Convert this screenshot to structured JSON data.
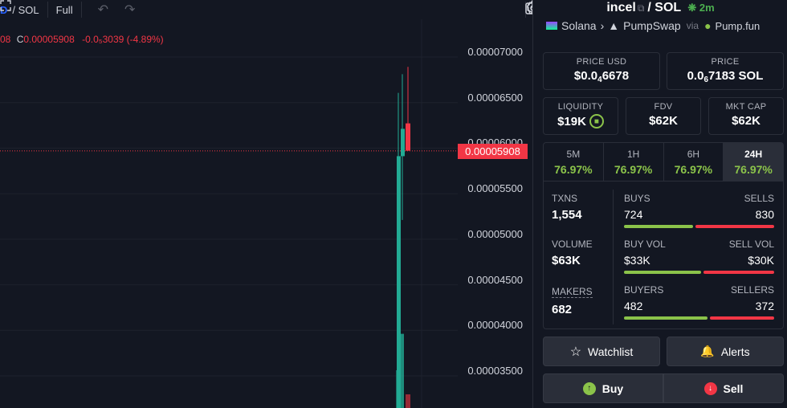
{
  "toolbar": {
    "pair_prefix": "D",
    "pair_suffix": "/ SOL",
    "full_label": "Full"
  },
  "legend": {
    "prefix": "08",
    "close_label": "C",
    "close_value": "0.00005908",
    "change": "-0.0₅3039 (-4.89%)"
  },
  "price_axis": [
    "0.00007000",
    "0.00006500",
    "0.00006000",
    "0.00005500",
    "0.00005000",
    "0.00004500",
    "0.00004000",
    "0.00003500"
  ],
  "current_price": "0.00005908",
  "colors": {
    "up": "#22ab94",
    "down": "#f23645",
    "positive": "#8bc34a",
    "background": "#131722"
  },
  "panel": {
    "token": "incel",
    "quote": "SOL",
    "age": "2m",
    "chain": "Solana",
    "dex": "PumpSwap",
    "via": "via",
    "launchpad": "Pump.fun",
    "price_usd_label": "PRICE USD",
    "price_usd_a": "$0.0",
    "price_usd_sub": "4",
    "price_usd_b": "6678",
    "price_label": "PRICE",
    "price_a": "0.0",
    "price_sub": "6",
    "price_b": "7183 SOL",
    "liquidity_label": "LIQUIDITY",
    "liquidity": "$19K",
    "fdv_label": "FDV",
    "fdv": "$62K",
    "mcap_label": "MKT CAP",
    "mcap": "$62K",
    "tabs": [
      {
        "label": "5M",
        "pct": "76.97%"
      },
      {
        "label": "1H",
        "pct": "76.97%"
      },
      {
        "label": "6H",
        "pct": "76.97%"
      },
      {
        "label": "24H",
        "pct": "76.97%"
      }
    ],
    "txns_label": "TXNS",
    "txns": "1,554",
    "buys_label": "BUYS",
    "buys": "724",
    "sells_label": "SELLS",
    "sells": "830",
    "buys_ratio": 0.466,
    "volume_label": "VOLUME",
    "volume": "$63K",
    "buyvol_label": "BUY VOL",
    "buyvol": "$33K",
    "sellvol_label": "SELL VOL",
    "sellvol": "$30K",
    "buyvol_ratio": 0.524,
    "makers_label": "MAKERS",
    "makers": "682",
    "buyers_label": "BUYERS",
    "buyers": "482",
    "sellers_label": "SELLERS",
    "sellers": "372",
    "buyers_ratio": 0.564,
    "watchlist_label": "Watchlist",
    "alerts_label": "Alerts",
    "buy_label": "Buy",
    "sell_label": "Sell"
  }
}
